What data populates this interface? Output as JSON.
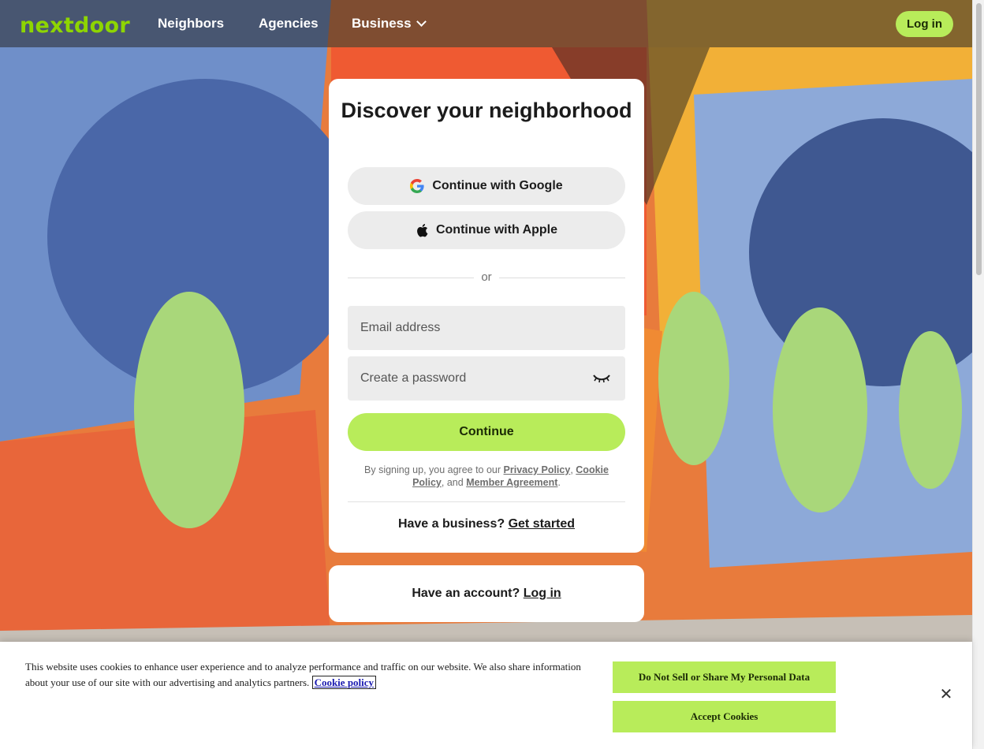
{
  "header": {
    "logo": "nextdoor",
    "nav": [
      "Neighbors",
      "Agencies",
      "Business"
    ],
    "login_label": "Log in"
  },
  "card": {
    "title": "Discover your neighborhood",
    "google_label": "Continue with Google",
    "apple_label": "Continue with Apple",
    "divider_text": "or",
    "email_placeholder": "Email address",
    "password_placeholder": "Create a password",
    "continue_label": "Continue",
    "legal_prefix": "By signing up, you agree to our",
    "privacy_link": "Privacy Policy",
    "comma": ",",
    "cookie_link": "Cookie Policy",
    "and_text": ", and",
    "member_link": "Member Agreement",
    "period": ".",
    "business_text": "Have a business?",
    "business_link": "Get started"
  },
  "account": {
    "text": "Have an account?",
    "link": "Log in"
  },
  "cookie_banner": {
    "text": "This website uses cookies to enhance user experience and to analyze performance and traffic on our website. We also share information about your use of our site with our advertising and analytics partners.",
    "policy_link": "Cookie policy",
    "do_not_sell_label": "Do Not Sell or Share My Personal Data",
    "accept_label": "Accept Cookies",
    "close_icon": "close-icon"
  },
  "colors": {
    "brand_green": "#8ed500",
    "button_green": "#b8ec5a"
  }
}
